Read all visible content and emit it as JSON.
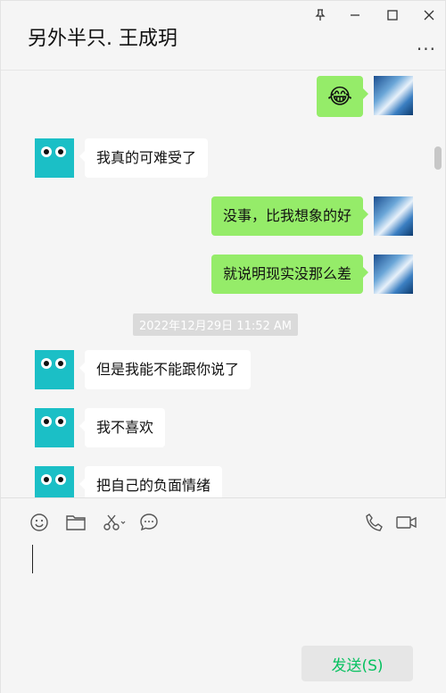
{
  "window": {
    "title": "另外半只. 王成玥",
    "more_label": "..."
  },
  "messages": [
    {
      "side": "right",
      "type": "emoji",
      "text": "😂"
    },
    {
      "side": "left",
      "text": "我真的可难受了"
    },
    {
      "side": "right",
      "text": "没事，比我想象的好"
    },
    {
      "side": "right",
      "text": "就说明现实没那么差"
    },
    {
      "side": "left",
      "text": "但是我能不能跟你说了"
    },
    {
      "side": "left",
      "text": "我不喜欢"
    },
    {
      "side": "left",
      "text": "把自己的负面情绪"
    }
  ],
  "timestamp": "2022年12月29日 11:52 AM",
  "toolbar": {
    "icons": [
      "emoji-icon",
      "folder-icon",
      "scissors-icon",
      "chat-bubble-icon",
      "phone-icon",
      "video-icon"
    ]
  },
  "send_button": {
    "label": "发送(S)"
  },
  "colors": {
    "bubble_green": "#95ec69",
    "bubble_white": "#ffffff",
    "send_text": "#07c160",
    "avatar_cyan": "#1bbfc6"
  }
}
